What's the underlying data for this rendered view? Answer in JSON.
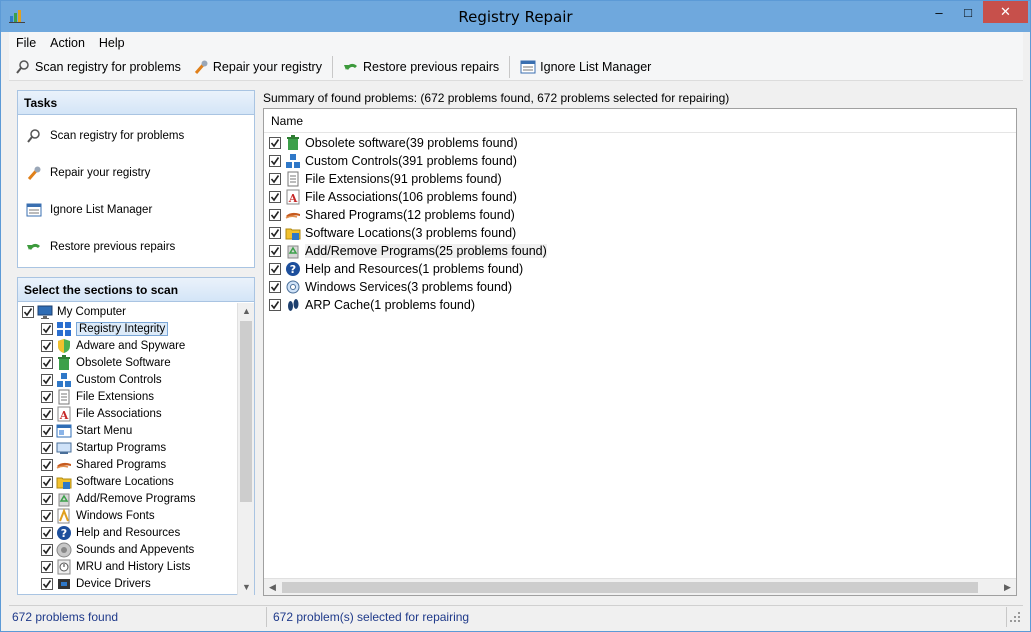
{
  "window": {
    "title": "Registry Repair",
    "min": "–",
    "max": "□",
    "close": "✕"
  },
  "menu": [
    "File",
    "Action",
    "Help"
  ],
  "toolbar": {
    "scan": "Scan registry for problems",
    "repair": "Repair your registry",
    "restore": "Restore previous repairs",
    "ignore": "Ignore List Manager"
  },
  "tasks": {
    "heading": "Tasks",
    "items": [
      "Scan registry for problems",
      "Repair your registry",
      "Ignore List Manager",
      "Restore previous repairs"
    ]
  },
  "sections": {
    "heading": "Select the sections to scan",
    "root": "My Computer",
    "items": [
      {
        "label": "Registry Integrity",
        "icon": "grid-icon"
      },
      {
        "label": "Adware and Spyware",
        "icon": "shield-icon"
      },
      {
        "label": "Obsolete Software",
        "icon": "trash-icon"
      },
      {
        "label": "Custom Controls",
        "icon": "blocks-icon"
      },
      {
        "label": "File Extensions",
        "icon": "file-icon"
      },
      {
        "label": "File Associations",
        "icon": "font-icon"
      },
      {
        "label": "Start Menu",
        "icon": "window-icon"
      },
      {
        "label": "Startup Programs",
        "icon": "monitor-icon"
      },
      {
        "label": "Shared Programs",
        "icon": "share-icon"
      },
      {
        "label": "Software Locations",
        "icon": "folder-icon"
      },
      {
        "label": "Add/Remove Programs",
        "icon": "recycle-icon"
      },
      {
        "label": "Windows Fonts",
        "icon": "font-file-icon"
      },
      {
        "label": "Help and Resources",
        "icon": "help-icon"
      },
      {
        "label": "Sounds and Appevents",
        "icon": "speaker-icon"
      },
      {
        "label": "MRU and History Lists",
        "icon": "clock-icon"
      },
      {
        "label": "Device Drivers",
        "icon": "chip-icon"
      }
    ]
  },
  "summary": "Summary of found problems: (672 problems found, 672 problems selected for repairing)",
  "list": {
    "column": "Name",
    "rows": [
      {
        "label": "Obsolete software(39 problems found)",
        "icon": "trash-icon"
      },
      {
        "label": "Custom Controls(391 problems found)",
        "icon": "blocks-icon"
      },
      {
        "label": "File Extensions(91 problems found)",
        "icon": "file-icon"
      },
      {
        "label": "File Associations(106 problems found)",
        "icon": "font-icon"
      },
      {
        "label": "Shared Programs(12 problems found)",
        "icon": "share-icon"
      },
      {
        "label": "Software Locations(3 problems found)",
        "icon": "folder-icon"
      },
      {
        "label": "Add/Remove Programs(25 problems found)",
        "icon": "recycle-icon"
      },
      {
        "label": "Help and Resources(1 problems found)",
        "icon": "help-icon"
      },
      {
        "label": "Windows Services(3 problems found)",
        "icon": "gear-icon"
      },
      {
        "label": "ARP Cache(1 problems found)",
        "icon": "footprints-icon"
      }
    ]
  },
  "status": {
    "found": "672 problems found",
    "selected": "672 problem(s) selected for repairing"
  },
  "colors": {
    "titlebar": "#6fa8dd",
    "close": "#c7504b",
    "status_text": "#1f3a8a"
  }
}
